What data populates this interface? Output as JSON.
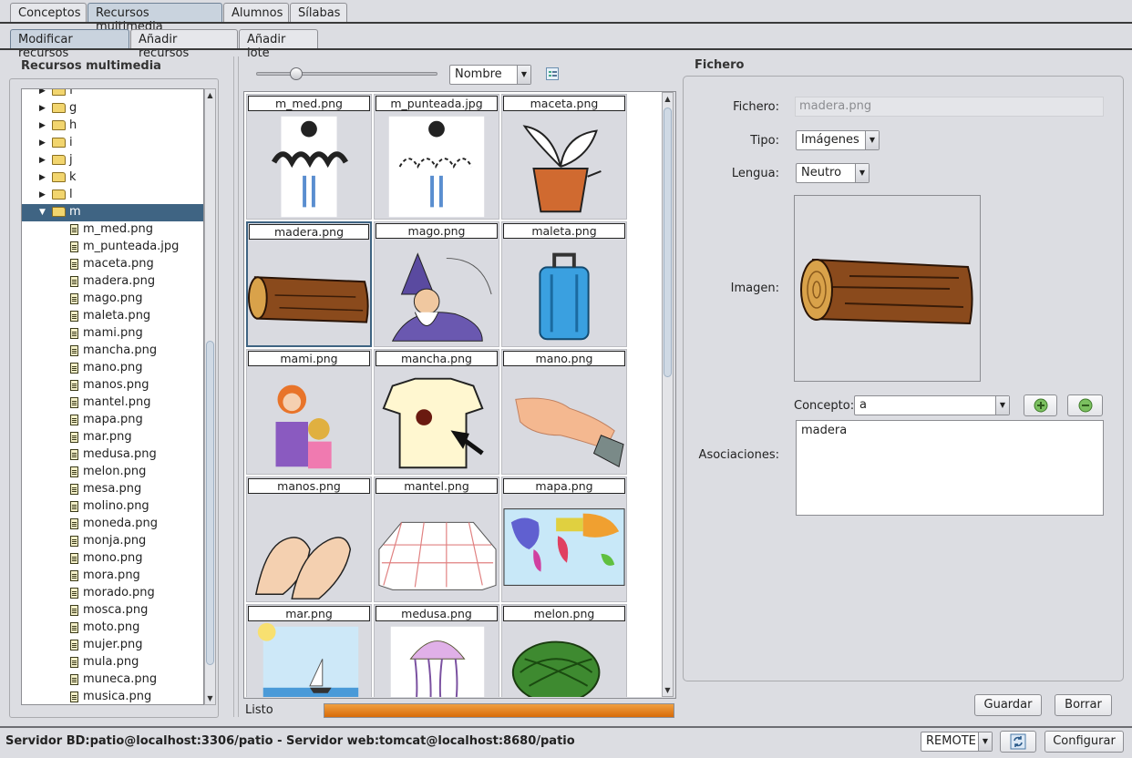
{
  "top_tabs": [
    "Conceptos",
    "Recursos multimedia",
    "Alumnos",
    "Sílabas"
  ],
  "sub_tabs": [
    "Modificar recursos",
    "Añadir recursos",
    "Añadir lote"
  ],
  "left_panel": {
    "title": "Recursos multimedia",
    "folders": [
      "f",
      "g",
      "h",
      "i",
      "j",
      "k",
      "l",
      "m"
    ],
    "selected_folder": "m",
    "files": [
      "m_med.png",
      "m_punteada.jpg",
      "maceta.png",
      "madera.png",
      "mago.png",
      "maleta.png",
      "mami.png",
      "mancha.png",
      "mano.png",
      "manos.png",
      "mantel.png",
      "mapa.png",
      "mar.png",
      "medusa.png",
      "melon.png",
      "mesa.png",
      "molino.png",
      "moneda.png",
      "monja.png",
      "mono.png",
      "mora.png",
      "morado.png",
      "mosca.png",
      "moto.png",
      "mujer.png",
      "mula.png",
      "muneca.png",
      "musica.png"
    ]
  },
  "center_panel": {
    "sort_value": "Nombre",
    "status": "Listo",
    "thumbnails": [
      "m_med.png",
      "m_punteada.jpg",
      "maceta.png",
      "madera.png",
      "mago.png",
      "maleta.png",
      "mami.png",
      "mancha.png",
      "mano.png",
      "manos.png",
      "mantel.png",
      "mapa.png",
      "mar.png",
      "medusa.png",
      "melon.png"
    ],
    "selected_thumbnail": "madera.png",
    "progress": 1.0
  },
  "right_panel": {
    "title": "Fichero",
    "fichero_label": "Fichero:",
    "fichero_value": "madera.png",
    "tipo_label": "Tipo:",
    "tipo_value": "Imágenes",
    "lengua_label": "Lengua:",
    "lengua_value": "Neutro",
    "imagen_label": "Imagen:",
    "concepto_label": "Concepto:",
    "concepto_value": "a",
    "asociaciones_label": "Asociaciones:",
    "asociaciones_value": "madera",
    "guardar": "Guardar",
    "borrar": "Borrar"
  },
  "status_bar": {
    "server_text": "Servidor BD:patio@localhost:3306/patio - Servidor web:tomcat@localhost:8680/patio",
    "mode_value": "REMOTE",
    "configurar": "Configurar"
  },
  "colors": {
    "selection": "#3f6483",
    "progress": "#e07b12",
    "background": "#dcdde2"
  }
}
